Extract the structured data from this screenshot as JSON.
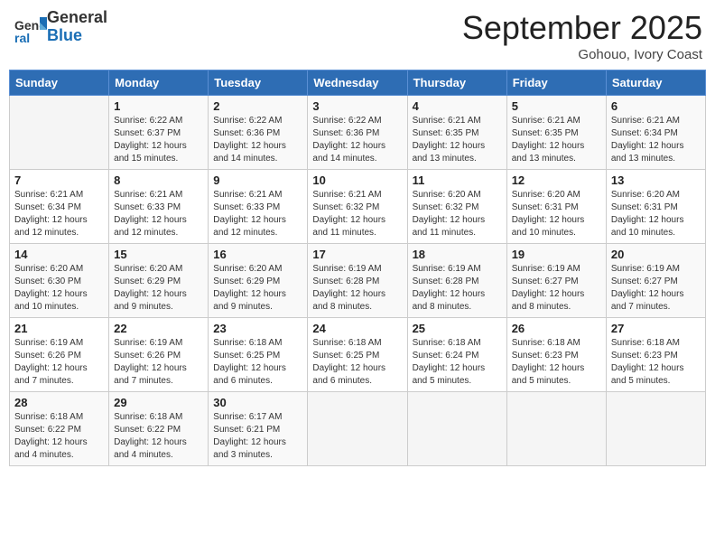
{
  "header": {
    "logo_general": "General",
    "logo_blue": "Blue",
    "month_title": "September 2025",
    "location": "Gohouo, Ivory Coast"
  },
  "weekdays": [
    "Sunday",
    "Monday",
    "Tuesday",
    "Wednesday",
    "Thursday",
    "Friday",
    "Saturday"
  ],
  "weeks": [
    [
      {
        "day": "",
        "empty": true
      },
      {
        "day": "1",
        "sunrise": "6:22 AM",
        "sunset": "6:37 PM",
        "daylight": "12 hours and 15 minutes."
      },
      {
        "day": "2",
        "sunrise": "6:22 AM",
        "sunset": "6:36 PM",
        "daylight": "12 hours and 14 minutes."
      },
      {
        "day": "3",
        "sunrise": "6:22 AM",
        "sunset": "6:36 PM",
        "daylight": "12 hours and 14 minutes."
      },
      {
        "day": "4",
        "sunrise": "6:21 AM",
        "sunset": "6:35 PM",
        "daylight": "12 hours and 13 minutes."
      },
      {
        "day": "5",
        "sunrise": "6:21 AM",
        "sunset": "6:35 PM",
        "daylight": "12 hours and 13 minutes."
      },
      {
        "day": "6",
        "sunrise": "6:21 AM",
        "sunset": "6:34 PM",
        "daylight": "12 hours and 13 minutes."
      }
    ],
    [
      {
        "day": "7",
        "sunrise": "6:21 AM",
        "sunset": "6:34 PM",
        "daylight": "12 hours and 12 minutes."
      },
      {
        "day": "8",
        "sunrise": "6:21 AM",
        "sunset": "6:33 PM",
        "daylight": "12 hours and 12 minutes."
      },
      {
        "day": "9",
        "sunrise": "6:21 AM",
        "sunset": "6:33 PM",
        "daylight": "12 hours and 12 minutes."
      },
      {
        "day": "10",
        "sunrise": "6:21 AM",
        "sunset": "6:32 PM",
        "daylight": "12 hours and 11 minutes."
      },
      {
        "day": "11",
        "sunrise": "6:20 AM",
        "sunset": "6:32 PM",
        "daylight": "12 hours and 11 minutes."
      },
      {
        "day": "12",
        "sunrise": "6:20 AM",
        "sunset": "6:31 PM",
        "daylight": "12 hours and 10 minutes."
      },
      {
        "day": "13",
        "sunrise": "6:20 AM",
        "sunset": "6:31 PM",
        "daylight": "12 hours and 10 minutes."
      }
    ],
    [
      {
        "day": "14",
        "sunrise": "6:20 AM",
        "sunset": "6:30 PM",
        "daylight": "12 hours and 10 minutes."
      },
      {
        "day": "15",
        "sunrise": "6:20 AM",
        "sunset": "6:29 PM",
        "daylight": "12 hours and 9 minutes."
      },
      {
        "day": "16",
        "sunrise": "6:20 AM",
        "sunset": "6:29 PM",
        "daylight": "12 hours and 9 minutes."
      },
      {
        "day": "17",
        "sunrise": "6:19 AM",
        "sunset": "6:28 PM",
        "daylight": "12 hours and 8 minutes."
      },
      {
        "day": "18",
        "sunrise": "6:19 AM",
        "sunset": "6:28 PM",
        "daylight": "12 hours and 8 minutes."
      },
      {
        "day": "19",
        "sunrise": "6:19 AM",
        "sunset": "6:27 PM",
        "daylight": "12 hours and 8 minutes."
      },
      {
        "day": "20",
        "sunrise": "6:19 AM",
        "sunset": "6:27 PM",
        "daylight": "12 hours and 7 minutes."
      }
    ],
    [
      {
        "day": "21",
        "sunrise": "6:19 AM",
        "sunset": "6:26 PM",
        "daylight": "12 hours and 7 minutes."
      },
      {
        "day": "22",
        "sunrise": "6:19 AM",
        "sunset": "6:26 PM",
        "daylight": "12 hours and 7 minutes."
      },
      {
        "day": "23",
        "sunrise": "6:18 AM",
        "sunset": "6:25 PM",
        "daylight": "12 hours and 6 minutes."
      },
      {
        "day": "24",
        "sunrise": "6:18 AM",
        "sunset": "6:25 PM",
        "daylight": "12 hours and 6 minutes."
      },
      {
        "day": "25",
        "sunrise": "6:18 AM",
        "sunset": "6:24 PM",
        "daylight": "12 hours and 5 minutes."
      },
      {
        "day": "26",
        "sunrise": "6:18 AM",
        "sunset": "6:23 PM",
        "daylight": "12 hours and 5 minutes."
      },
      {
        "day": "27",
        "sunrise": "6:18 AM",
        "sunset": "6:23 PM",
        "daylight": "12 hours and 5 minutes."
      }
    ],
    [
      {
        "day": "28",
        "sunrise": "6:18 AM",
        "sunset": "6:22 PM",
        "daylight": "12 hours and 4 minutes."
      },
      {
        "day": "29",
        "sunrise": "6:18 AM",
        "sunset": "6:22 PM",
        "daylight": "12 hours and 4 minutes."
      },
      {
        "day": "30",
        "sunrise": "6:17 AM",
        "sunset": "6:21 PM",
        "daylight": "12 hours and 3 minutes."
      },
      {
        "day": "",
        "empty": true
      },
      {
        "day": "",
        "empty": true
      },
      {
        "day": "",
        "empty": true
      },
      {
        "day": "",
        "empty": true
      }
    ]
  ]
}
